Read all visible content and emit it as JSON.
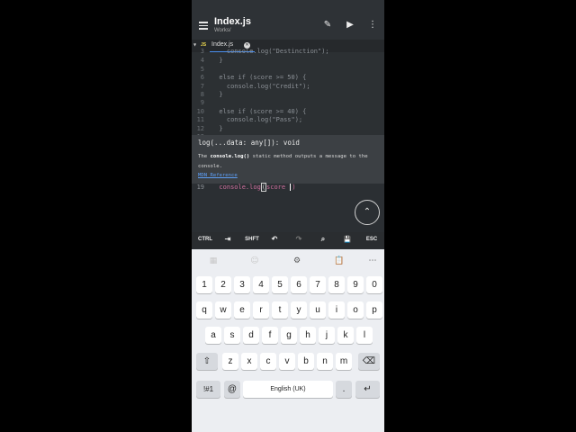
{
  "app": {
    "title": "Index.js",
    "subtitle": "Works/",
    "actions": {
      "edit": "✎",
      "run": "▶",
      "more": "⋮"
    }
  },
  "tab": {
    "badge": "JS",
    "name": "Index.js",
    "close": "✕"
  },
  "editor": {
    "lines": [
      {
        "n": "3",
        "code": "    console.log(\"Destinction\");"
      },
      {
        "n": "4",
        "code": "  }"
      },
      {
        "n": "5",
        "code": ""
      },
      {
        "n": "6",
        "code": "  else if (score >= 50) {"
      },
      {
        "n": "7",
        "code": "    console.log(\"Credit\");"
      },
      {
        "n": "8",
        "code": "  }"
      },
      {
        "n": "9",
        "code": ""
      },
      {
        "n": "10",
        "code": "  else if (score >= 40) {"
      },
      {
        "n": "11",
        "code": "    console.log(\"Pass\");"
      },
      {
        "n": "12",
        "code": "  }"
      },
      {
        "n": "13",
        "code": ""
      }
    ],
    "current_line": {
      "n": "19",
      "prefix": "  console.log(",
      "bracket": "(",
      "text": "score "
    }
  },
  "hint": {
    "signature": "log(...data: any[]): void",
    "desc_pre": "The ",
    "desc_code": "console.log()",
    "desc_post": " static method outputs a message to the console.",
    "link": "MDN Reference"
  },
  "keybar": {
    "ctrl": "CTRL",
    "tab": "⇥",
    "shift": "SHFT",
    "undo": "↶",
    "redo": "↷",
    "search": "⌕",
    "save": "💾",
    "esc": "ESC"
  },
  "keyboard": {
    "toolbar": {
      "t1": "▦",
      "t2": "☺",
      "t3": "⚙",
      "t4": "📋",
      "t5": "⋯"
    },
    "row_numbers": [
      "1",
      "2",
      "3",
      "4",
      "5",
      "6",
      "7",
      "8",
      "9",
      "0"
    ],
    "row1": [
      "q",
      "w",
      "e",
      "r",
      "t",
      "y",
      "u",
      "i",
      "o",
      "p"
    ],
    "row2": [
      "a",
      "s",
      "d",
      "f",
      "g",
      "h",
      "j",
      "k",
      "l"
    ],
    "row3": [
      "z",
      "x",
      "c",
      "v",
      "b",
      "n",
      "m"
    ],
    "shift": "⇧",
    "backspace": "⌫",
    "sym": "!#1",
    "at": "@",
    "space": "English (UK)",
    "period": ".",
    "enter": "↵"
  }
}
